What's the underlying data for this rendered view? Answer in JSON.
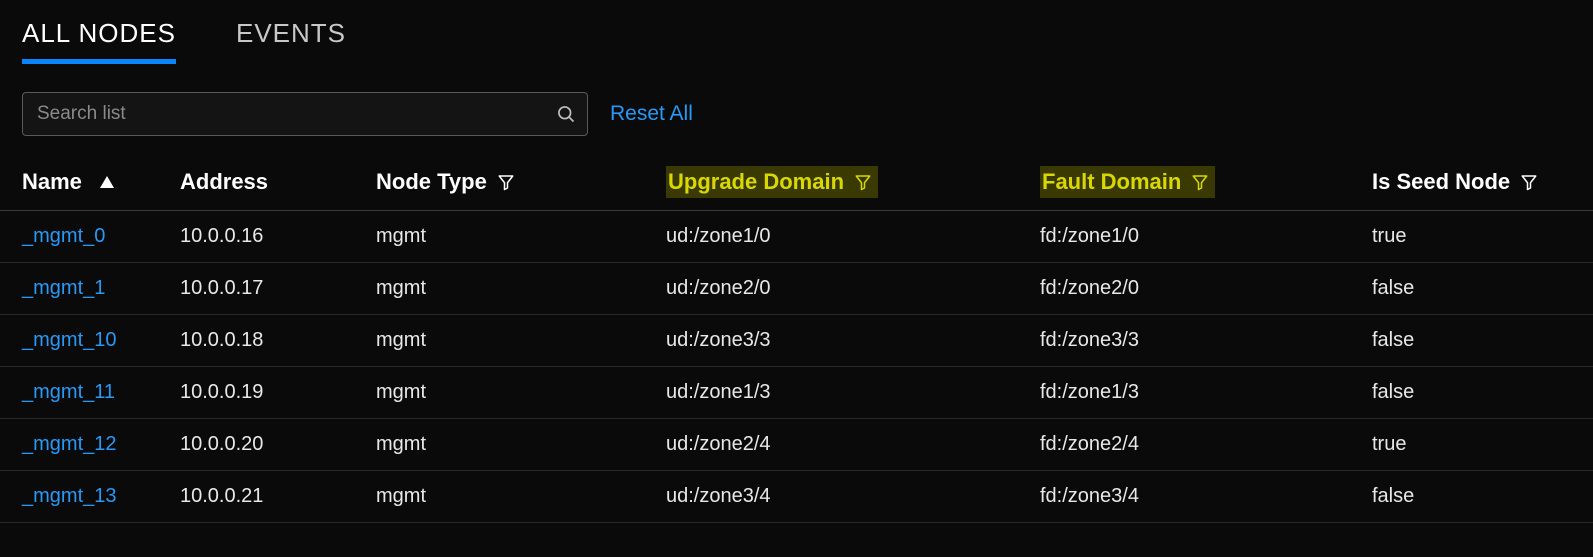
{
  "tabs": {
    "all_nodes": "ALL NODES",
    "events": "EVENTS"
  },
  "search": {
    "placeholder": "Search list"
  },
  "reset_label": "Reset All",
  "columns": {
    "name": "Name",
    "address": "Address",
    "node_type": "Node Type",
    "upgrade_domain": "Upgrade Domain",
    "fault_domain": "Fault Domain",
    "is_seed_node": "Is Seed Node"
  },
  "rows": [
    {
      "name": "_mgmt_0",
      "address": "10.0.0.16",
      "node_type": "mgmt",
      "upgrade_domain": "ud:/zone1/0",
      "fault_domain": "fd:/zone1/0",
      "is_seed_node": "true"
    },
    {
      "name": "_mgmt_1",
      "address": "10.0.0.17",
      "node_type": "mgmt",
      "upgrade_domain": "ud:/zone2/0",
      "fault_domain": "fd:/zone2/0",
      "is_seed_node": "false"
    },
    {
      "name": "_mgmt_10",
      "address": "10.0.0.18",
      "node_type": "mgmt",
      "upgrade_domain": "ud:/zone3/3",
      "fault_domain": "fd:/zone3/3",
      "is_seed_node": "false"
    },
    {
      "name": "_mgmt_11",
      "address": "10.0.0.19",
      "node_type": "mgmt",
      "upgrade_domain": "ud:/zone1/3",
      "fault_domain": "fd:/zone1/3",
      "is_seed_node": "false"
    },
    {
      "name": "_mgmt_12",
      "address": "10.0.0.20",
      "node_type": "mgmt",
      "upgrade_domain": "ud:/zone2/4",
      "fault_domain": "fd:/zone2/4",
      "is_seed_node": "true"
    },
    {
      "name": "_mgmt_13",
      "address": "10.0.0.21",
      "node_type": "mgmt",
      "upgrade_domain": "ud:/zone3/4",
      "fault_domain": "fd:/zone3/4",
      "is_seed_node": "false"
    }
  ]
}
